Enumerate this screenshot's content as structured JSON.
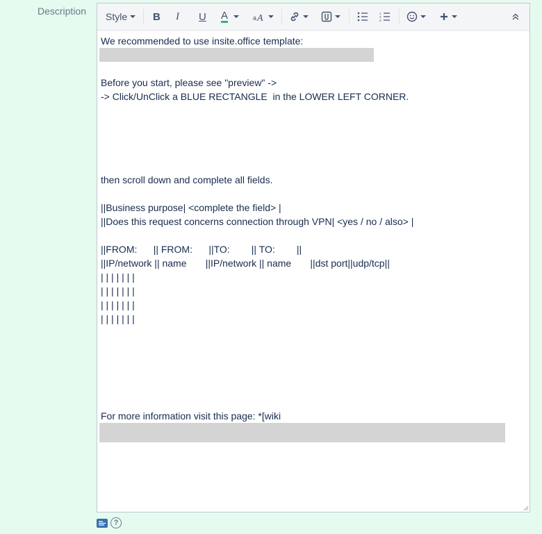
{
  "field": {
    "label": "Description"
  },
  "toolbar": {
    "style_label": "Style",
    "bold": "B",
    "italic": "I",
    "underline": "U",
    "text_color": "A"
  },
  "content": {
    "lines": [
      "We recommended to use insite.office template:",
      "",
      "",
      "Before you start, please see \"preview\" ->",
      "-> Click/UnClick a BLUE RECTANGLE  in the LOWER LEFT CORNER.",
      "",
      "",
      "",
      "",
      "",
      "then scroll down and complete all fields.",
      "",
      "||Business purpose| <complete the field> |",
      "||Does this request concerns connection through VPN| <yes / no / also> |",
      "",
      "||FROM:      || FROM:      ||TO:        || TO:        ||",
      "||IP/network || name       ||IP/network || name       ||dst port||udp/tcp||",
      "| | | | | | |",
      "| | | | | | |",
      "| | | | | | |",
      "| | | | | | |",
      "",
      "",
      "",
      "",
      "",
      "",
      "For more information visit this page: *[wiki"
    ]
  },
  "footer": {
    "help_glyph": "?"
  }
}
